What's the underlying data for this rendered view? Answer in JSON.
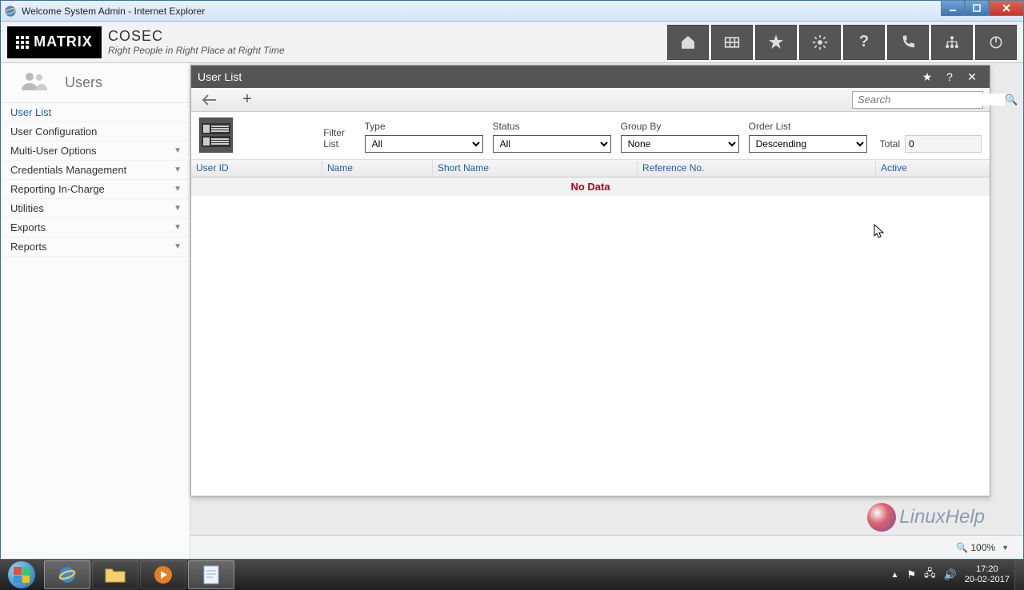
{
  "window": {
    "title": "Welcome System Admin - Internet Explorer"
  },
  "brand": {
    "logo": "MATRIX",
    "product": "COSEC",
    "tagline": "Right People in Right Place at Right Time"
  },
  "sidebar": {
    "heading": "Users",
    "items": [
      {
        "label": "User List",
        "active": true,
        "expandable": false
      },
      {
        "label": "User Configuration",
        "active": false,
        "expandable": false
      },
      {
        "label": "Multi-User Options",
        "active": false,
        "expandable": true
      },
      {
        "label": "Credentials Management",
        "active": false,
        "expandable": true
      },
      {
        "label": "Reporting In-Charge",
        "active": false,
        "expandable": true
      },
      {
        "label": "Utilities",
        "active": false,
        "expandable": true
      },
      {
        "label": "Exports",
        "active": false,
        "expandable": true
      },
      {
        "label": "Reports",
        "active": false,
        "expandable": true
      }
    ]
  },
  "panel": {
    "title": "User List",
    "search_placeholder": "Search",
    "filter_label": "Filter List",
    "filters": {
      "type": {
        "label": "Type",
        "value": "All"
      },
      "status": {
        "label": "Status",
        "value": "All"
      },
      "group_by": {
        "label": "Group By",
        "value": "None"
      },
      "order": {
        "label": "Order List",
        "value": "Descending"
      }
    },
    "total_label": "Total",
    "total_value": "0",
    "columns": [
      "User ID",
      "Name",
      "Short Name",
      "Reference No.",
      "Active"
    ],
    "empty_text": "No Data"
  },
  "status": {
    "zoom": "100%"
  },
  "watermark": "LinuxHelp",
  "tray": {
    "time": "17:20",
    "date": "20-02-2017"
  }
}
